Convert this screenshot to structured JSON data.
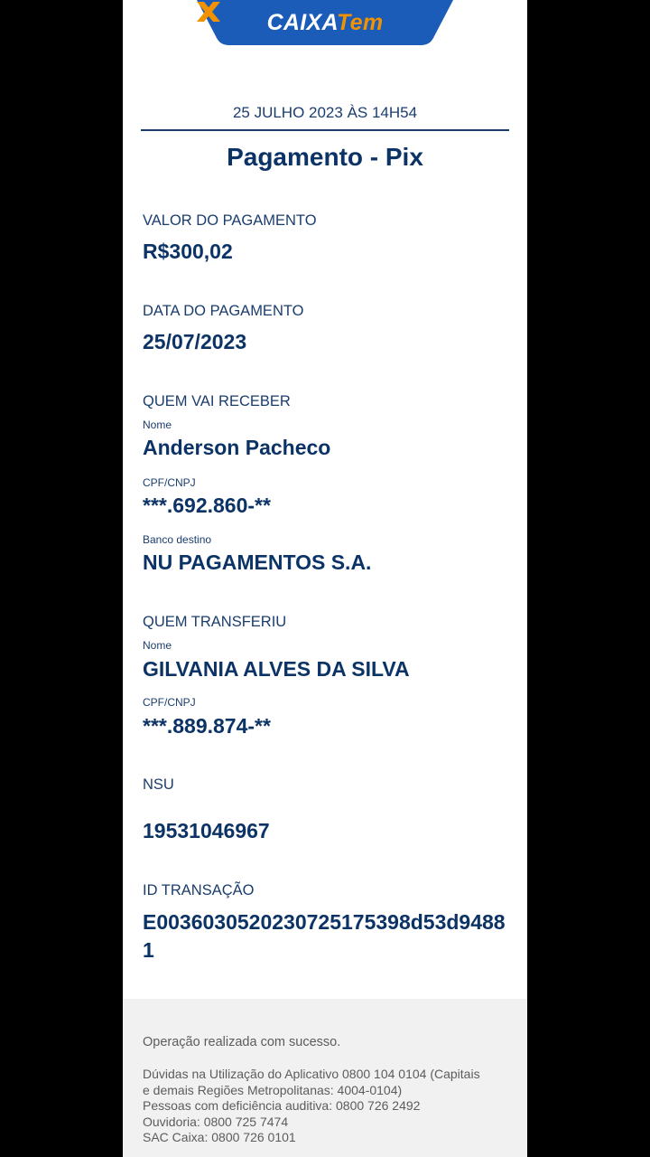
{
  "brand": {
    "name_main": "CAIXA",
    "name_accent": "Tem",
    "colors": {
      "primary": "#0c3366",
      "tab": "#1a5cb8",
      "accent": "#f39200"
    }
  },
  "receipt": {
    "datetime": "25 JULHO 2023 ÀS 14H54",
    "title": "Pagamento - Pix",
    "amount_label": "VALOR DO PAGAMENTO",
    "amount_value": "R$300,02",
    "date_label": "DATA DO PAGAMENTO",
    "date_value": "25/07/2023",
    "receiver": {
      "section_label": "QUEM VAI RECEBER",
      "name_label": "Nome",
      "name_value": "Anderson Pacheco",
      "doc_label": "CPF/CNPJ",
      "doc_value": "***.692.860-**",
      "bank_label": "Banco destino",
      "bank_value": "NU PAGAMENTOS S.A."
    },
    "sender": {
      "section_label": "QUEM TRANSFERIU",
      "name_label": "Nome",
      "name_value": "GILVANIA ALVES DA SILVA",
      "doc_label": "CPF/CNPJ",
      "doc_value": "***.889.874-**"
    },
    "nsu_label": "NSU",
    "nsu_value": "19531046967",
    "transaction_label": "ID TRANSAÇÃO",
    "transaction_value": "E00360305202307251753​98d53d94881"
  },
  "footer": {
    "status": "Operação realizada com sucesso.",
    "info_lines": [
      "Dúvidas na Utilização do Aplicativo 0800 104 0104 (Capitais",
      "e demais Regiões Metropolitanas: 4004-0104)",
      "Pessoas com deficiência auditiva: 0800 726 2492",
      "Ouvidoria: 0800 725 7474",
      "SAC Caixa: 0800 726 0101"
    ]
  }
}
